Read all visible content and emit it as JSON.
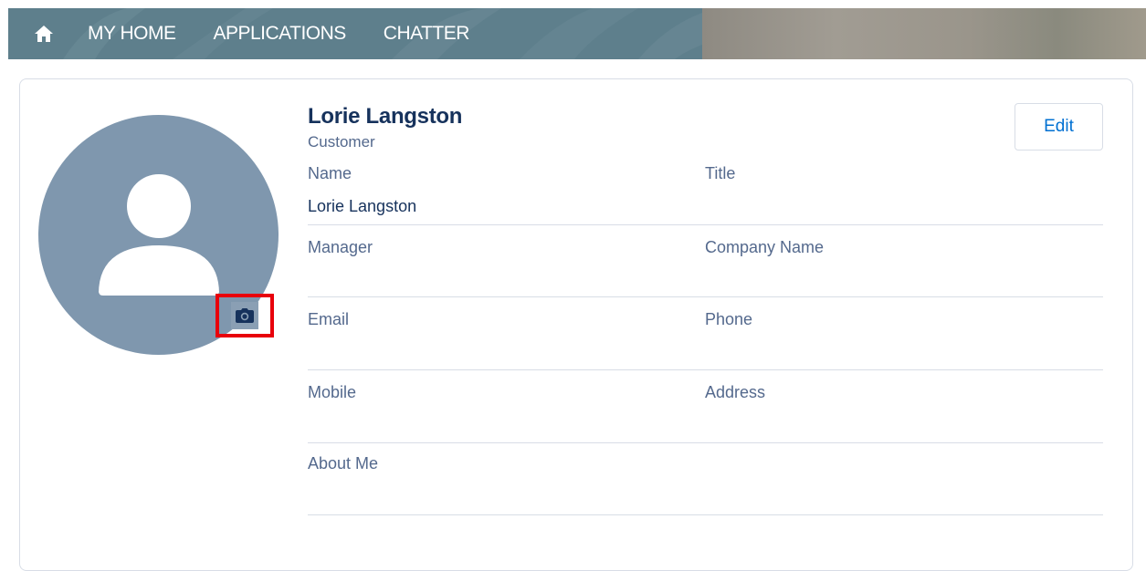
{
  "nav": {
    "items": [
      {
        "label": "MY HOME"
      },
      {
        "label": "APPLICATIONS"
      },
      {
        "label": "CHATTER"
      }
    ],
    "home_icon": "home-icon"
  },
  "profile": {
    "name": "Lorie Langston",
    "type": "Customer",
    "edit_label": "Edit",
    "avatar_icon": "user-placeholder-icon",
    "camera_icon": "camera-icon",
    "fields": {
      "name_label": "Name",
      "name_value": "Lorie Langston",
      "title_label": "Title",
      "manager_label": "Manager",
      "company_label": "Company Name",
      "email_label": "Email",
      "phone_label": "Phone",
      "mobile_label": "Mobile",
      "address_label": "Address",
      "about_label": "About Me"
    }
  },
  "colors": {
    "nav_bg": "#5e7f8c",
    "avatar_bg": "#7f97ae",
    "highlight": "#e8000b",
    "link": "#0070d2"
  }
}
